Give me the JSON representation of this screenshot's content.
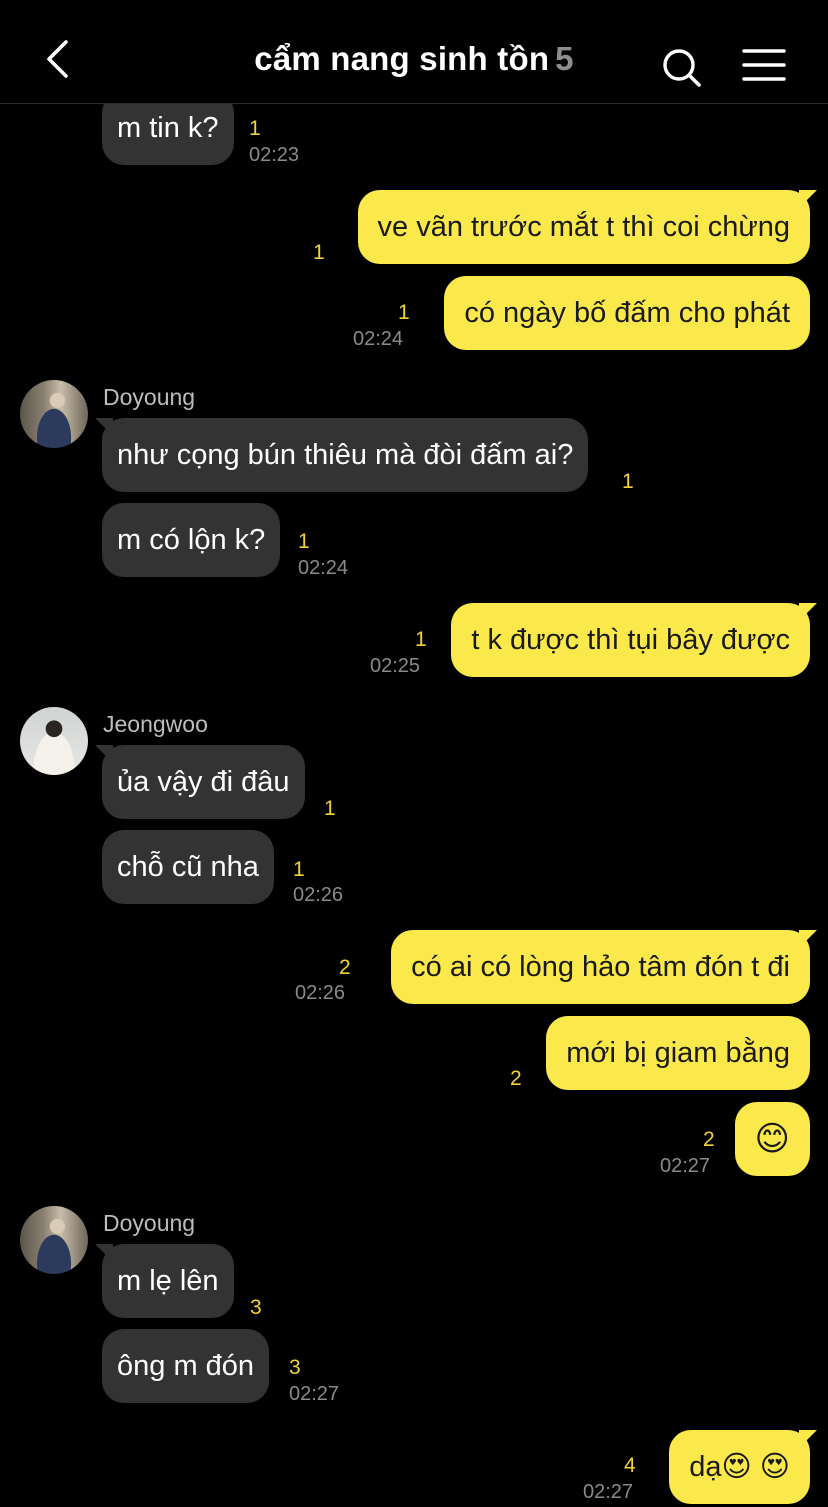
{
  "header": {
    "title": "cẩm nang sinh tồn",
    "member_count": "5"
  },
  "icons": {
    "back": "chevron-left-icon",
    "search": "search-icon",
    "menu": "hamburger-menu-icon"
  },
  "colors": {
    "background": "#000000",
    "incoming_bubble": "#333333",
    "outgoing_bubble": "#fbe84a",
    "unread_count": "#f3d23b",
    "timestamp": "#8a8a8a"
  },
  "messages": [
    {
      "dir": "in",
      "text": "m tin k?",
      "unread": "1",
      "time": "02:23"
    },
    {
      "dir": "out",
      "text": "ve vãn trước mắt t thì coi chừng",
      "unread": "1"
    },
    {
      "dir": "out",
      "text": "có ngày bố đấm cho phát",
      "unread": "1",
      "time": "02:24"
    },
    {
      "dir": "in",
      "sender": "Doyoung",
      "text": "như cọng bún thiêu mà đòi đấm ai?",
      "unread": "1"
    },
    {
      "dir": "in",
      "text": "m có lộn k?",
      "unread": "1",
      "time": "02:24"
    },
    {
      "dir": "out",
      "text": "t k được thì tụi bây được",
      "unread": "1",
      "time": "02:25"
    },
    {
      "dir": "in",
      "sender": "Jeongwoo",
      "text": "ủa vậy đi đâu",
      "unread": "1"
    },
    {
      "dir": "in",
      "text": "chỗ cũ nha",
      "unread": "1",
      "time": "02:26"
    },
    {
      "dir": "out",
      "text": "có ai có lòng hảo tâm đón t đi",
      "unread": "2",
      "time": "02:26"
    },
    {
      "dir": "out",
      "text": "mới bị giam bằng",
      "unread": "2"
    },
    {
      "dir": "out",
      "text": "😊",
      "unread": "2",
      "time": "02:27"
    },
    {
      "dir": "in",
      "sender": "Doyoung",
      "text": "m lẹ lên",
      "unread": "3"
    },
    {
      "dir": "in",
      "text": "ông m đón",
      "unread": "3",
      "time": "02:27"
    },
    {
      "dir": "out",
      "text": "dạ😍 😍",
      "unread": "4",
      "time": "02:27"
    }
  ]
}
